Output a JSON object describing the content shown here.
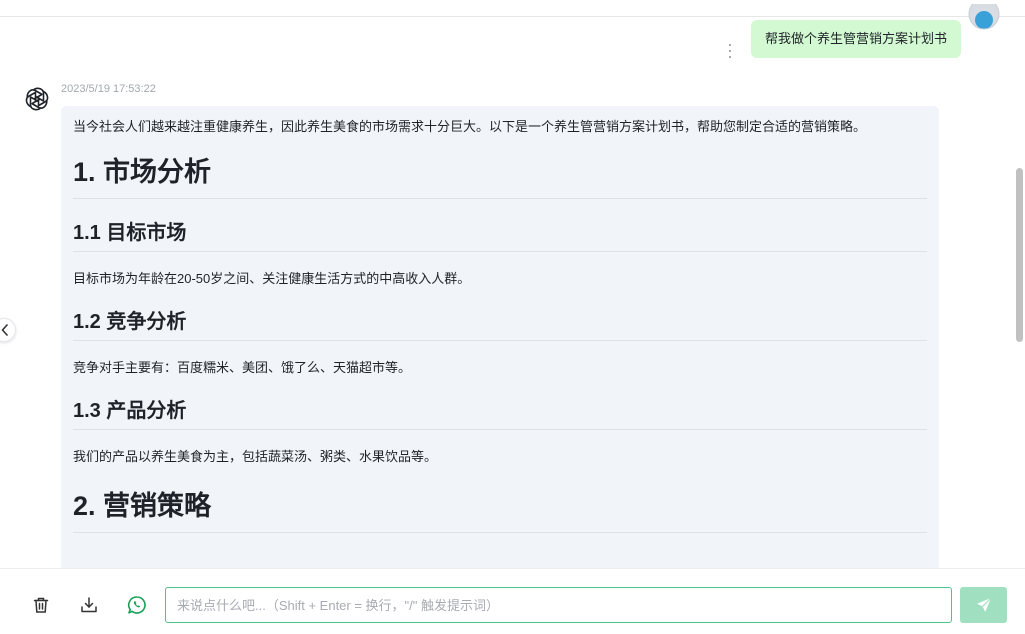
{
  "conversation": {
    "user_message": "帮我做个养生管营销方案计划书",
    "assistant": {
      "timestamp": "2023/5/19 17:53:22",
      "intro": "当今社会人们越来越注重健康养生，因此养生美食的市场需求十分巨大。以下是一个养生管营销方案计划书，帮助您制定合适的营销策略。",
      "section1_title": "1. 市场分析",
      "sub1_title": "1.1 目标市场",
      "sub1_text": "目标市场为年龄在20-50岁之间、关注健康生活方式的中高收入人群。",
      "sub2_title": "1.2 竞争分析",
      "sub2_text": "竞争对手主要有：百度糯米、美团、饿了么、天猫超市等。",
      "sub3_title": "1.3 产品分析",
      "sub3_text": "我们的产品以养生美食为主，包括蔬菜汤、粥类、水果饮品等。",
      "section2_title": "2. 营销策略"
    }
  },
  "input": {
    "value": "",
    "placeholder": "来说点什么吧...（Shift + Enter = 换行，\"/\" 触发提示词）"
  },
  "icons": {
    "left_collapse": "chevron-left-icon",
    "user_avatar": "user-avatar-icon",
    "message_more": "more-vertical-icon",
    "bot_avatar": "openai-logo-icon",
    "clear": "trash-icon",
    "export": "download-icon",
    "whatsapp": "whatsapp-icon",
    "send": "send-icon"
  },
  "colors": {
    "accent": "#4cc58a",
    "send_button": "#a0dfc0",
    "user_bubble": "#d2f9d1",
    "bot_bubble": "#f1f4f8",
    "whatsapp": "#18a058"
  }
}
